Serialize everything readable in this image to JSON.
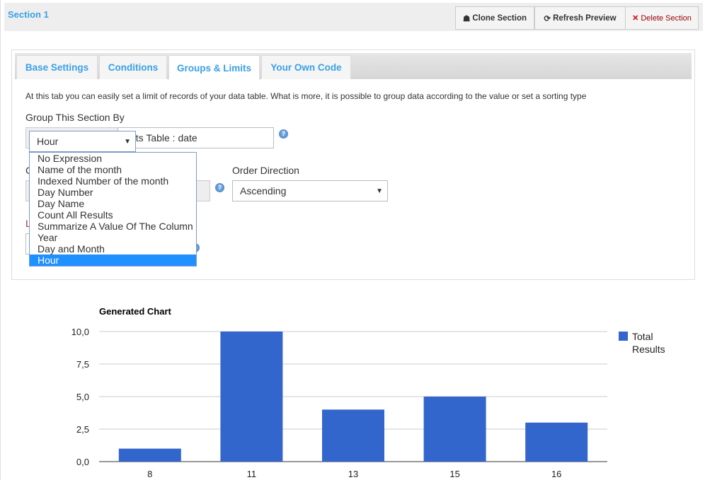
{
  "header": {
    "title": "Section 1",
    "clone": "Clone Section",
    "refresh": "Refresh Preview",
    "delete": "Delete Section"
  },
  "tabs": [
    {
      "label": "Base Settings"
    },
    {
      "label": "Conditions"
    },
    {
      "label": "Groups & Limits",
      "active": true
    },
    {
      "label": "Your Own Code"
    }
  ],
  "description": "At this tab you can easily set a limit of records of your data table. What is more, it is possible to group data according to the value or set a sorting type",
  "group": {
    "label": "Group This Section By",
    "expression_value": "Hour",
    "column_value": "kets Table : date"
  },
  "order": {
    "label_fragment": "C",
    "direction_label": "Order Direction",
    "direction_value": "Ascending"
  },
  "limit": {
    "label_fragment": "L"
  },
  "dropdown": {
    "options": [
      "No Expression",
      "Name of the month",
      "Indexed Number of the month",
      "Day Number",
      "Day Name",
      "Count All Results",
      "Summarize A Value Of The Column",
      "Year",
      "Day and Month",
      "Hour"
    ],
    "selected": "Hour"
  },
  "chart_data": {
    "type": "bar",
    "title": "Generated Chart",
    "categories": [
      "8",
      "11",
      "13",
      "15",
      "16"
    ],
    "series": [
      {
        "name": "Total Results",
        "values": [
          1,
          10,
          4,
          5,
          3
        ],
        "color": "#3366cc"
      }
    ],
    "yticks": [
      "0,0",
      "2,5",
      "5,0",
      "7,5",
      "10,0"
    ],
    "ylim": [
      0,
      10
    ],
    "grid": true,
    "legend": "right"
  },
  "colors": {
    "accent": "#3aa0e6",
    "highlight": "#1e90ff",
    "delete": "#cc0000"
  }
}
